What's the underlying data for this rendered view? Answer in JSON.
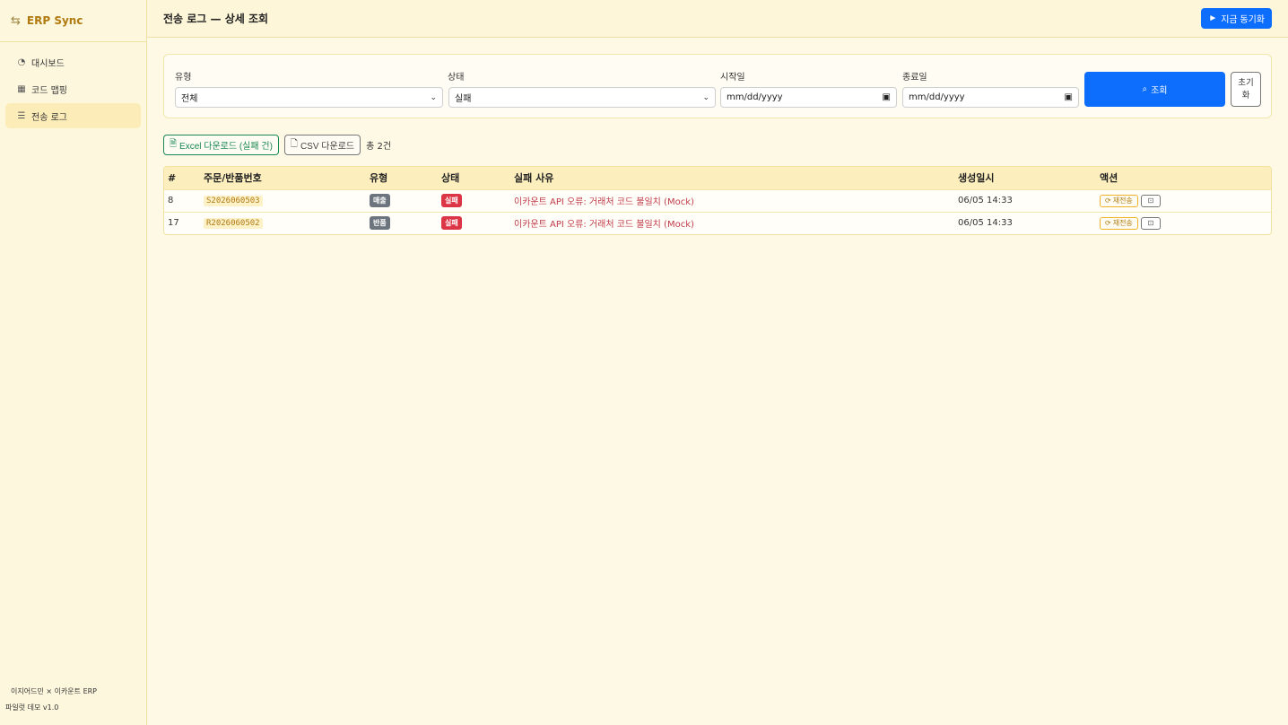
{
  "sidebar": {
    "brand": "ERP Sync",
    "items": [
      {
        "label": "대시보드",
        "icon": "speedometer-icon",
        "active": false
      },
      {
        "label": "코드 맵핑",
        "icon": "table-icon",
        "active": false
      },
      {
        "label": "전송 로그",
        "icon": "list-icon",
        "active": true
      }
    ],
    "footer_line1": "이지어드민 × 이카운트 ERP",
    "footer_line2": "파일럿 데모 v1.0"
  },
  "header": {
    "title": "전송 로그 — 상세 조회",
    "sync_label": "지금 동기화"
  },
  "filters": {
    "type_label": "유형",
    "type_value": "전체",
    "status_label": "상태",
    "status_value": "실패",
    "start_label": "시작일",
    "start_placeholder": "mm/dd/yyyy",
    "end_label": "종료일",
    "end_placeholder": "mm/dd/yyyy",
    "search_label": "조회",
    "reset_label": "초기화"
  },
  "downloads": {
    "excel_label": "Excel 다운로드 (실패 건)",
    "csv_label": "CSV 다운로드",
    "total": "총 2건"
  },
  "table": {
    "columns": [
      "#",
      "주문/반품번호",
      "유형",
      "상태",
      "실패 사유",
      "생성일시",
      "액션"
    ],
    "rows": [
      {
        "id": "8",
        "order_no": "S2026060503",
        "type": "매출",
        "status": "실패",
        "reason": "이카운트 API 오류: 거래처 코드 불일치 (Mock)",
        "created": "06/05 14:33",
        "resend": "재전송"
      },
      {
        "id": "17",
        "order_no": "R2026060502",
        "type": "반품",
        "status": "실패",
        "reason": "이카운트 API 오류: 거래처 코드 불일치 (Mock)",
        "created": "06/05 14:33",
        "resend": "재전송"
      }
    ]
  },
  "colors": {
    "primary": "#0d6efd",
    "brand": "#b07a10",
    "danger": "#dc3545",
    "success": "#198754",
    "background": "#fdf9e4"
  }
}
